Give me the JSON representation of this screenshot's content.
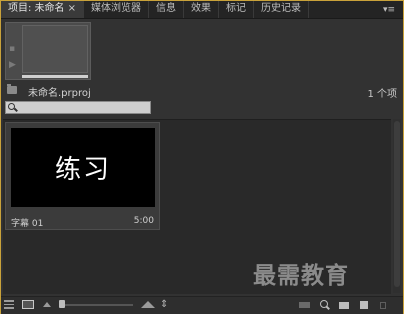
{
  "tabs": [
    {
      "label": "项目: 未命名",
      "active": true,
      "close": "×"
    },
    {
      "label": "媒体浏览器"
    },
    {
      "label": "信息"
    },
    {
      "label": "效果"
    },
    {
      "label": "标记"
    },
    {
      "label": "历史记录"
    }
  ],
  "project": {
    "name": "未命名.prproj",
    "item_count": "1 个项"
  },
  "search": {
    "value": "",
    "placeholder": ""
  },
  "clip": {
    "thumbnail_text": "练习",
    "name": "字幕 01",
    "duration": "5:00"
  },
  "watermark": "最需教育",
  "colors": {
    "panel_border": "#c9a23a",
    "search_bg": "#cfcfcf",
    "thumbnail_bg": "#000000"
  },
  "icons": {
    "panel_menu": "panel-menu-icon",
    "folder": "folder-icon",
    "search": "search-icon",
    "list_view": "list-view-icon",
    "icon_view": "icon-view-icon",
    "sort": "sort-icon",
    "automate": "automate-to-sequence-icon",
    "find": "find-icon",
    "new_bin": "new-bin-icon",
    "new_item": "new-item-icon",
    "clear": "trash-icon"
  }
}
